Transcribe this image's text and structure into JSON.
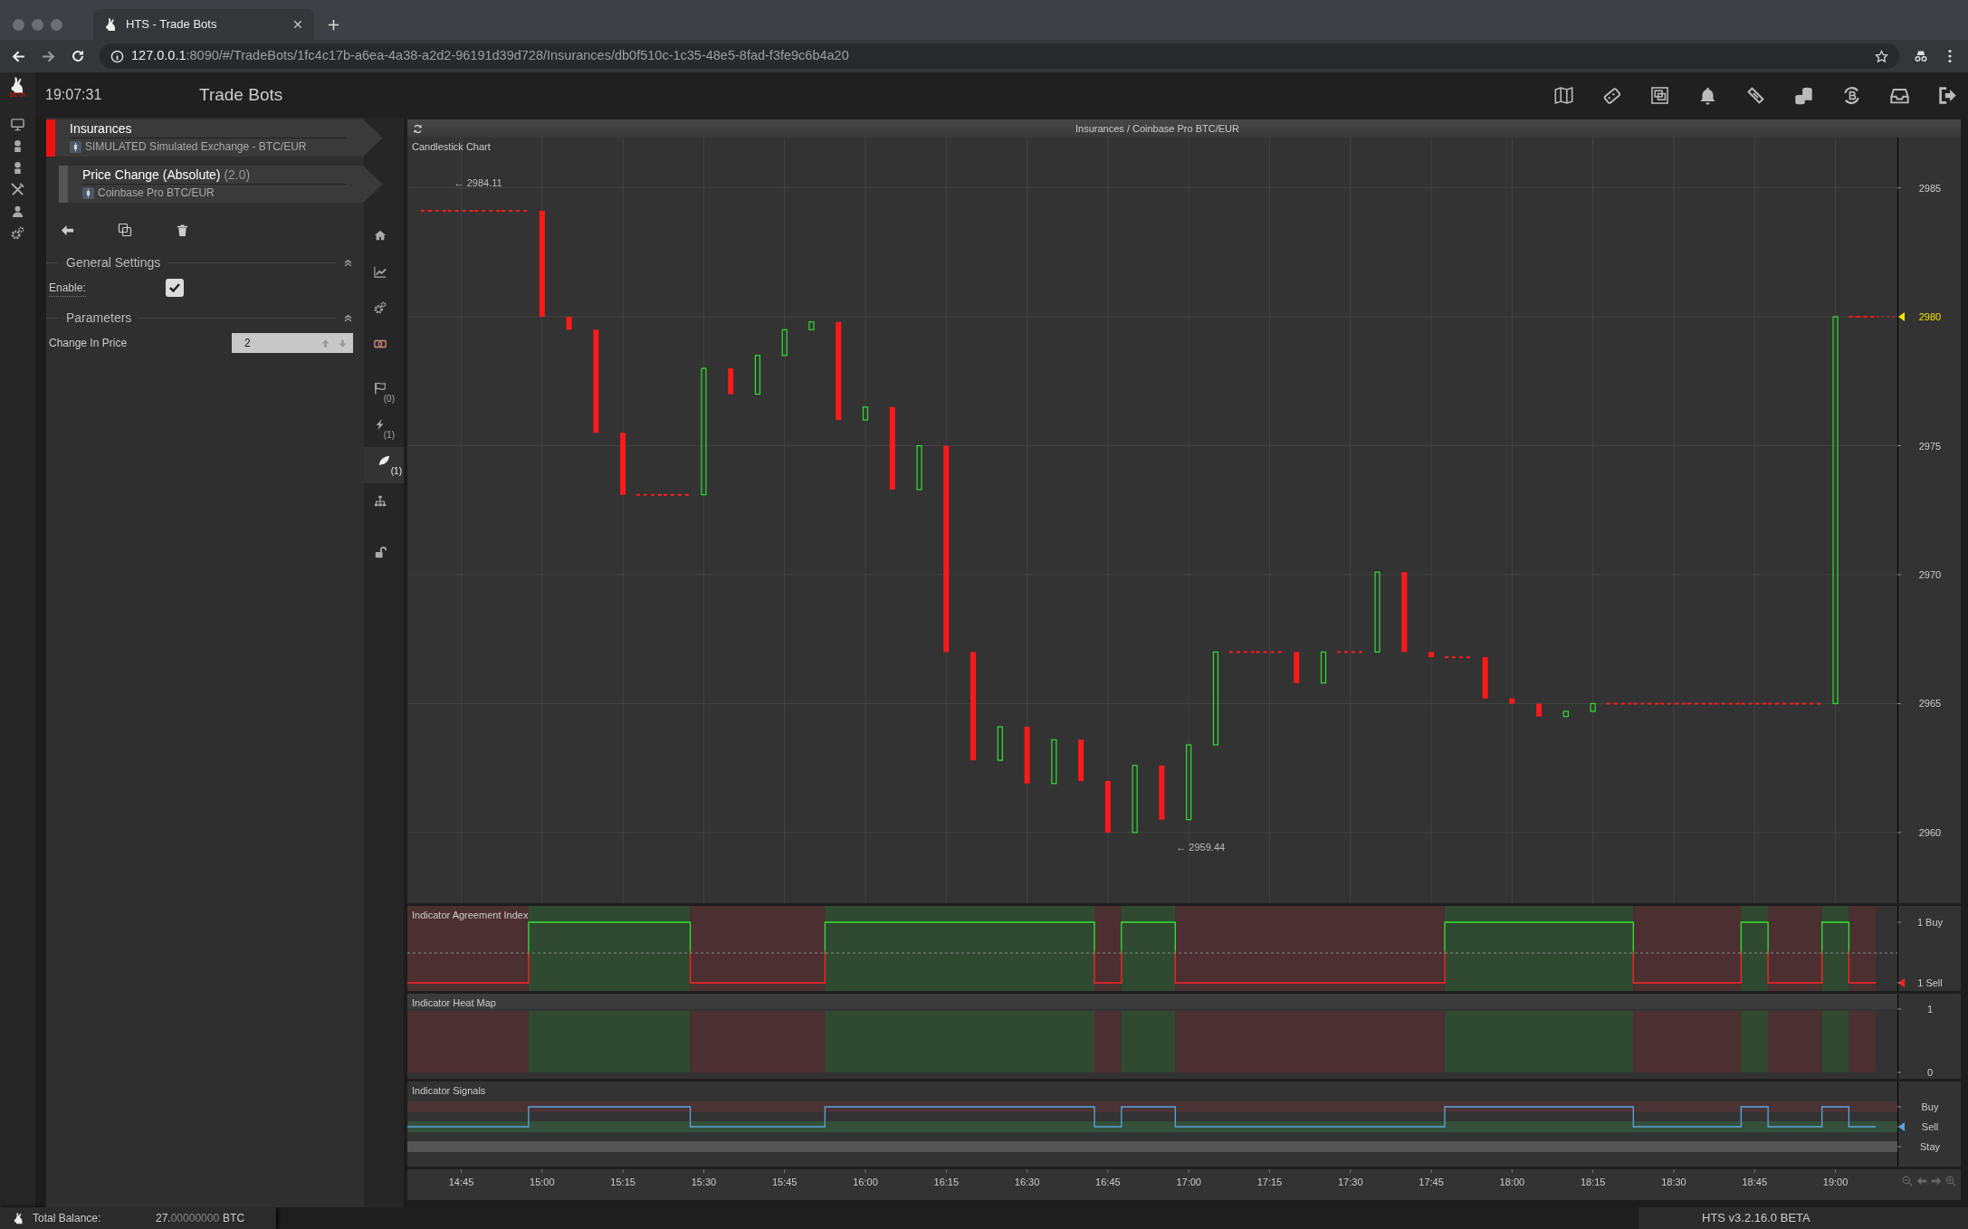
{
  "browser": {
    "tab_title": "HTS - Trade Bots",
    "url_host": "127.0.0.1",
    "url_rest": ":8090/#/TradeBots/1fc4c17b-a6ea-4a38-a2d2-96191d39d728/Insurances/db0f510c-1c35-48e5-8fad-f3fe9c6b4a20"
  },
  "header": {
    "logo_badge": "BETA",
    "clock": "19:07:31",
    "title": "Trade Bots"
  },
  "tree": [
    {
      "title": "Insurances",
      "subtitle": "SIMULATED Simulated Exchange - BTC/EUR",
      "selected": true,
      "children": [
        {
          "title": "Price Change (Absolute)",
          "version": "(2.0)",
          "subtitle": "Coinbase Pro BTC/EUR",
          "selected": false
        }
      ]
    }
  ],
  "settings": [
    {
      "title": "General Settings",
      "expanded": true,
      "fields": [
        {
          "kind": "checkbox",
          "label": "Enable:",
          "checked": true
        }
      ]
    },
    {
      "title": "Parameters",
      "expanded": true,
      "fields": [
        {
          "kind": "number",
          "label": "Change In Price",
          "value": "2"
        }
      ]
    }
  ],
  "side_tabs": [
    {
      "selected": false
    },
    {
      "selected": false
    },
    {
      "selected": false
    },
    {
      "selected": false
    },
    {
      "selected": false,
      "count": "(0)"
    },
    {
      "selected": false,
      "count": "(1)"
    },
    {
      "selected": true,
      "count": "(1)"
    },
    {
      "selected": false
    },
    {
      "selected": false
    }
  ],
  "chart_panel": {
    "title": "Insurances / Coinbase Pro BTC/EUR",
    "main": {
      "title": "Candlestick Chart",
      "y_axis_labels": [
        "2985",
        "2975",
        "2970",
        "2965",
        "2960"
      ],
      "last_price": "2980",
      "price_notes": [
        "← 2984.11",
        "← 2959.44"
      ]
    },
    "indicators": [
      {
        "kind": "agreement",
        "title": "Indicator Agreement Index",
        "axis_labels": [
          "1 Buy",
          "1 Sell"
        ]
      },
      {
        "kind": "heatmap",
        "title": "Indicator Heat Map",
        "axis_labels": [
          "1",
          "0"
        ]
      },
      {
        "kind": "signals",
        "title": "Indicator Signals",
        "axis_labels": [
          "Buy",
          "Sell",
          "Stay"
        ]
      }
    ],
    "time_axis_labels": [
      "14:45",
      "15:00",
      "15:15",
      "15:30",
      "15:45",
      "16:00",
      "16:15",
      "16:30",
      "16:45",
      "17:00",
      "17:15",
      "17:30",
      "17:45",
      "18:00",
      "18:15",
      "18:30",
      "18:45",
      "19:00"
    ]
  },
  "status_bar": {
    "balance_label": "Total Balance:",
    "balance_whole": "27.",
    "balance_fraction": "00000000",
    "currency": "BTC",
    "version": "HTS v3.2.16.0 BETA"
  }
}
